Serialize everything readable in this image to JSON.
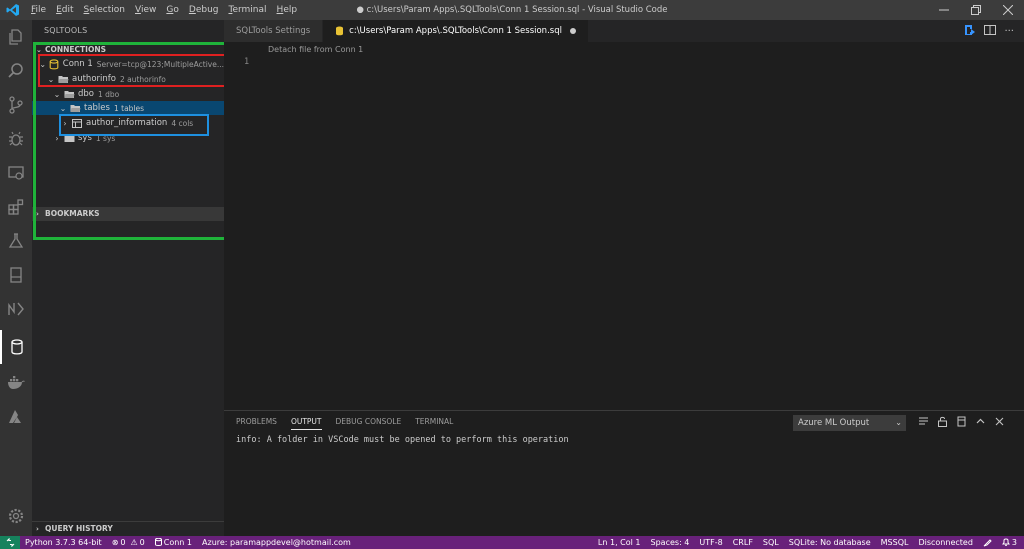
{
  "titlebar": {
    "menus": [
      {
        "first": "F",
        "rest": "ile"
      },
      {
        "first": "E",
        "rest": "dit"
      },
      {
        "first": "S",
        "rest": "election"
      },
      {
        "first": "V",
        "rest": "iew"
      },
      {
        "first": "G",
        "rest": "o"
      },
      {
        "first": "D",
        "rest": "ebug"
      },
      {
        "first": "T",
        "rest": "erminal"
      },
      {
        "first": "H",
        "rest": "elp"
      }
    ],
    "title": "● c:\\Users\\Param Apps\\.SQLTools\\Conn 1 Session.sql - Visual Studio Code"
  },
  "sidebar": {
    "title": "SQLTOOLS",
    "connections_header": "CONNECTIONS",
    "bookmarks_header": "BOOKMARKS",
    "query_history_header": "QUERY HISTORY",
    "tree": [
      {
        "label": "Conn 1",
        "desc": "Server=tcp@123;MultipleActive..."
      },
      {
        "label": "authorinfo",
        "desc": "2 authorinfo"
      },
      {
        "label": "dbo",
        "desc": "1 dbo"
      },
      {
        "label": "tables",
        "desc": "1 tables"
      },
      {
        "label": "author_information",
        "desc": "4 cols"
      },
      {
        "label": "sys",
        "desc": "1 sys"
      }
    ]
  },
  "tabs": [
    {
      "label": "SQLTools Settings"
    },
    {
      "label": "c:\\Users\\Param Apps\\.SQLTools\\Conn 1 Session.sql"
    }
  ],
  "editor": {
    "codelens": "Detach file from Conn 1",
    "line_number": "1"
  },
  "panel": {
    "tabs": [
      "PROBLEMS",
      "OUTPUT",
      "DEBUG CONSOLE",
      "TERMINAL"
    ],
    "active_tab": "OUTPUT",
    "output_channel": "Azure ML Output",
    "output_text": "info: A folder in VSCode must be opened to perform this operation"
  },
  "statusbar": {
    "python": "Python 3.7.3 64-bit",
    "errors": "0",
    "warnings": "0",
    "connection": "Conn 1",
    "azure": "Azure: paramappdevel@hotmail.com",
    "position": "Ln 1, Col 1",
    "spaces": "Spaces: 4",
    "encoding": "UTF-8",
    "eol": "CRLF",
    "language": "SQL",
    "sqlite": "SQLite: No database",
    "mssql": "MSSQL",
    "disconnected": "Disconnected",
    "notifications": "3"
  },
  "colors": {
    "statusbar": "#68217a",
    "annot_green": "#1fb33a",
    "annot_red": "#e02020",
    "annot_blue": "#1e90e0",
    "selection": "#094771"
  }
}
